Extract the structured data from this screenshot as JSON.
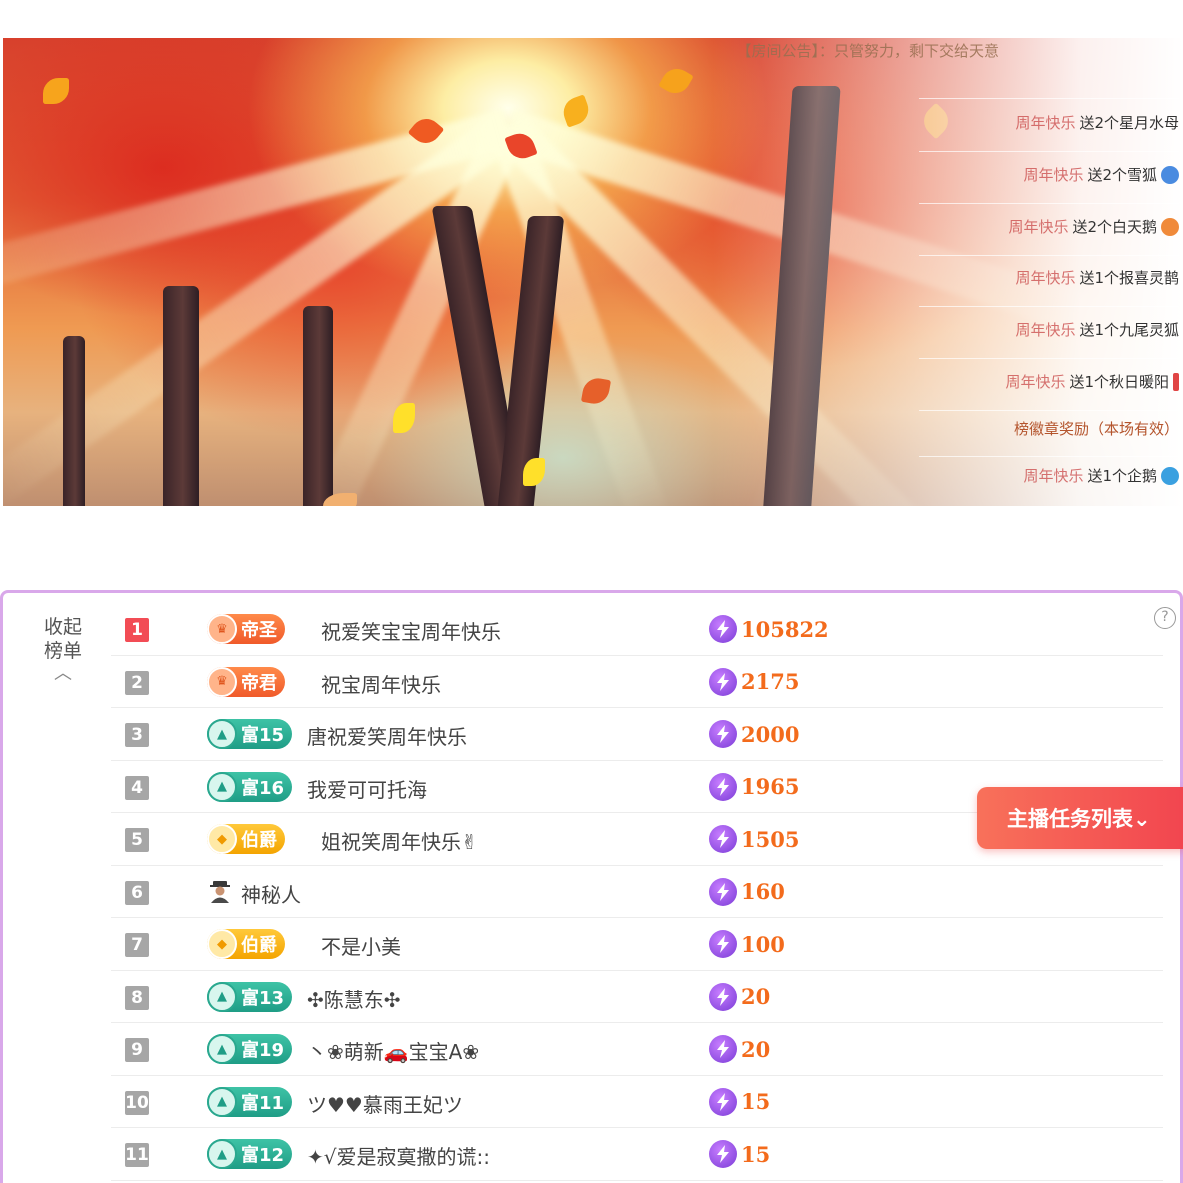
{
  "chat": {
    "announcement": "【房间公告】：只管努力，剩下交给天意",
    "lines": [
      {
        "who": "周年快乐",
        "gift": "送2个星月水母",
        "icon_color": ""
      },
      {
        "who": "周年快乐",
        "gift": "送2个雪狐",
        "icon_color": "#4a8be0"
      },
      {
        "who": "周年快乐",
        "gift": "送2个白天鹅",
        "icon_color": "#f08a3a"
      },
      {
        "who": "周年快乐",
        "gift": "送1个报喜灵鹊",
        "icon_color": ""
      },
      {
        "who": "周年快乐",
        "gift": "送1个九尾灵狐",
        "icon_color": ""
      },
      {
        "who": "周年快乐",
        "gift": "送1个秋日暖阳",
        "icon_color": "#e04545"
      }
    ],
    "flash_notice": "榜徽章奖励（本场有效）",
    "last_line": {
      "who": "周年快乐",
      "gift": "送1个企鹅",
      "icon_color": "#3aa0e0"
    }
  },
  "panel": {
    "collapse_label_1": "收起",
    "collapse_label_2": "榜单",
    "collapse_icon": "chevron-up-icon",
    "help_label": "?",
    "task_button": "主播任务列表⌄",
    "rows": [
      {
        "rank": "1",
        "badge_type": "emperor",
        "badge": "帝圣",
        "name": "祝爱笑宝宝周年快乐",
        "score": "105822"
      },
      {
        "rank": "2",
        "badge_type": "emperor",
        "badge": "帝君",
        "name": "祝宝周年快乐",
        "score": "2175"
      },
      {
        "rank": "3",
        "badge_type": "rich",
        "badge": "富15",
        "name": "唐祝爱笑周年快乐",
        "score": "2000"
      },
      {
        "rank": "4",
        "badge_type": "rich",
        "badge": "富16",
        "name": "我爱可可托海",
        "score": "1965"
      },
      {
        "rank": "5",
        "badge_type": "duke",
        "badge": "伯爵",
        "name": "姐祝笑周年快乐✌",
        "score": "1505"
      },
      {
        "rank": "6",
        "badge_type": "none",
        "badge": "",
        "name": "神秘人",
        "score": "160"
      },
      {
        "rank": "7",
        "badge_type": "duke",
        "badge": "伯爵",
        "name": "不是小美",
        "score": "100"
      },
      {
        "rank": "8",
        "badge_type": "rich",
        "badge": "富13",
        "name": "✣陈慧东✣",
        "score": "20"
      },
      {
        "rank": "9",
        "badge_type": "rich",
        "badge": "富19",
        "name": "丶❀萌新🚗宝宝A❀",
        "score": "20"
      },
      {
        "rank": "10",
        "badge_type": "rich",
        "badge": "富11",
        "name": "ツ♥♥慕雨王妃ツ",
        "score": "15"
      },
      {
        "rank": "11",
        "badge_type": "rich",
        "badge": "富12",
        "name": "✦√爱是寂寞撒的谎::",
        "score": "15"
      }
    ]
  }
}
